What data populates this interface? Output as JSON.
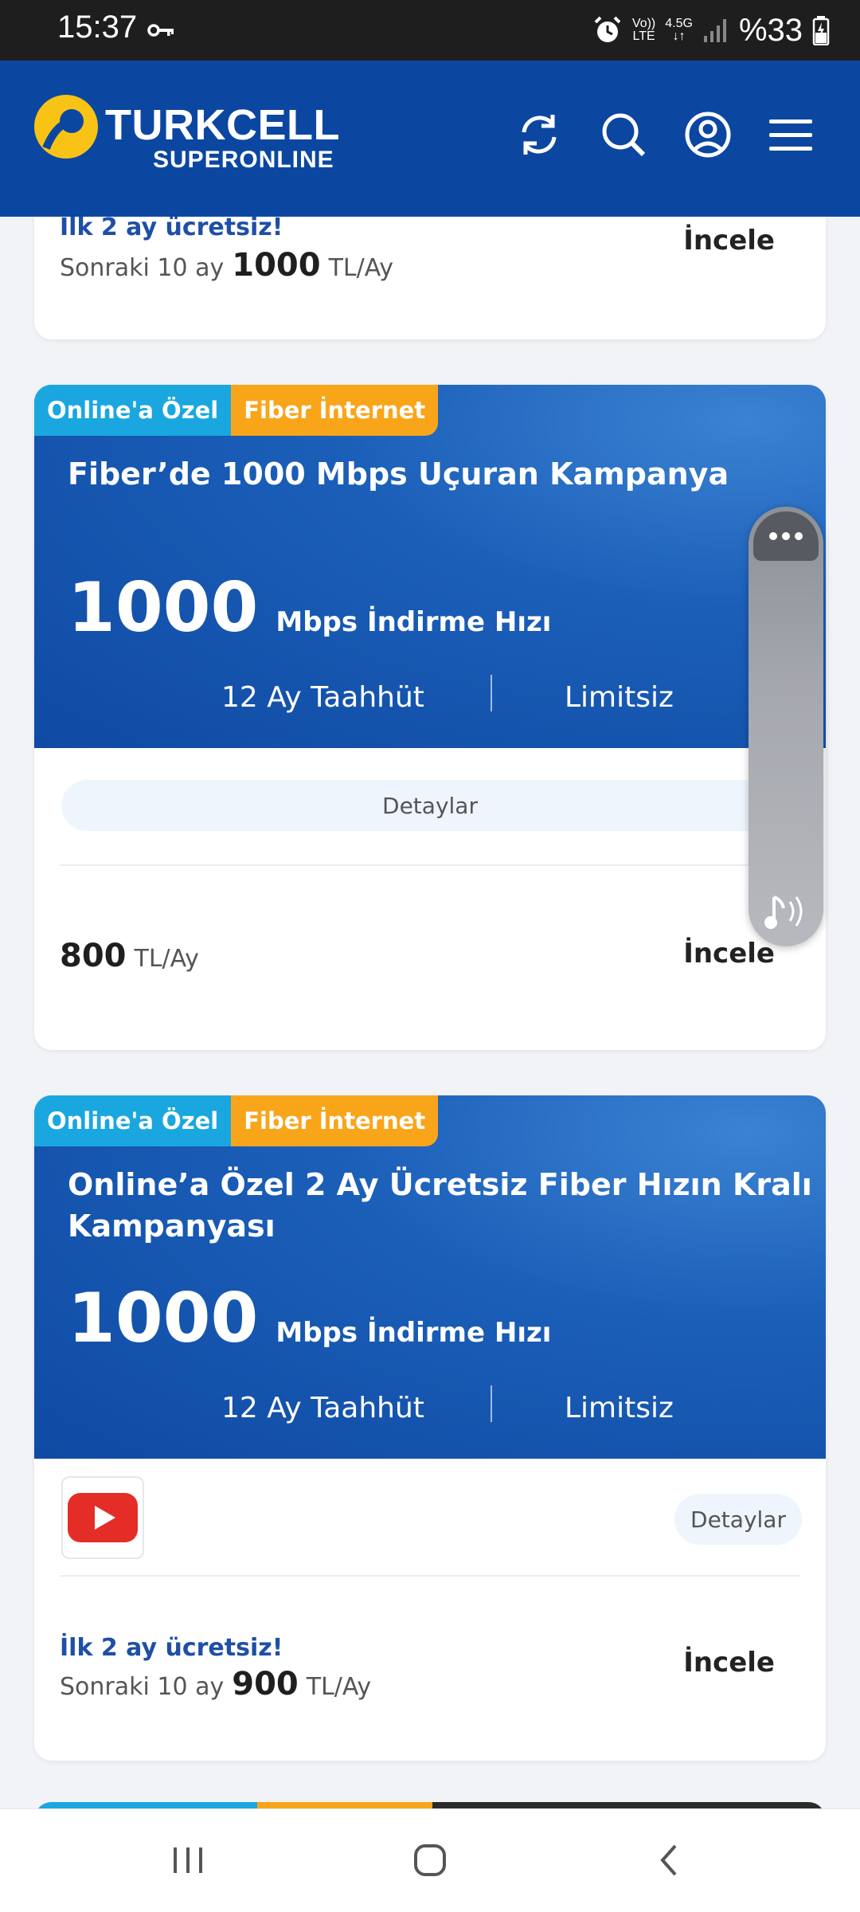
{
  "status_bar": {
    "time": "15:37",
    "network_top": "Vo))",
    "network_bottom": "LTE",
    "network_gen": "4.5G",
    "battery": "%33"
  },
  "header": {
    "brand": "TURKCELL",
    "brand_sub": "SUPERONLINE",
    "icons": [
      "refresh-icon",
      "search-icon",
      "account-icon",
      "menu-icon"
    ],
    "colors": {
      "primary": "#0b47a1",
      "accent": "#f9c315"
    }
  },
  "card0": {
    "promo": "İlk 2 ay ücretsiz!",
    "prefix": "Sonraki 10 ay",
    "price": "1000",
    "unit": "TL/Ay",
    "cta": "İncele"
  },
  "card1": {
    "tag_online": "Online'a Özel",
    "tag_fiber": "Fiber İnternet",
    "title": "Fiber’de 1000 Mbps Uçuran Kampanya",
    "speed": "1000",
    "speed_unit": "Mbps İndirme Hızı",
    "commitment": "12 Ay Taahhüt",
    "quota": "Limitsiz",
    "details": "Detaylar",
    "price": "800",
    "unit": "TL/Ay",
    "cta": "İncele"
  },
  "card2": {
    "tag_online": "Online'a Özel",
    "tag_fiber": "Fiber İnternet",
    "title_line1": "Online’a Özel 2 Ay Ücretsiz Fiber Hızın Kralı",
    "title_line2": "Kampanyası",
    "speed": "1000",
    "speed_unit": "Mbps İndirme Hızı",
    "commitment": "12 Ay Taahhüt",
    "quota": "Limitsiz",
    "details": "Detaylar",
    "promo": "İlk 2 ay ücretsiz!",
    "prefix": "Sonraki 10 ay",
    "price": "900",
    "unit": "TL/Ay",
    "cta": "İncele",
    "addon_icon": "youtube-icon"
  },
  "navbar": {
    "icons": [
      "recent-apps-icon",
      "home-icon",
      "back-icon"
    ]
  }
}
